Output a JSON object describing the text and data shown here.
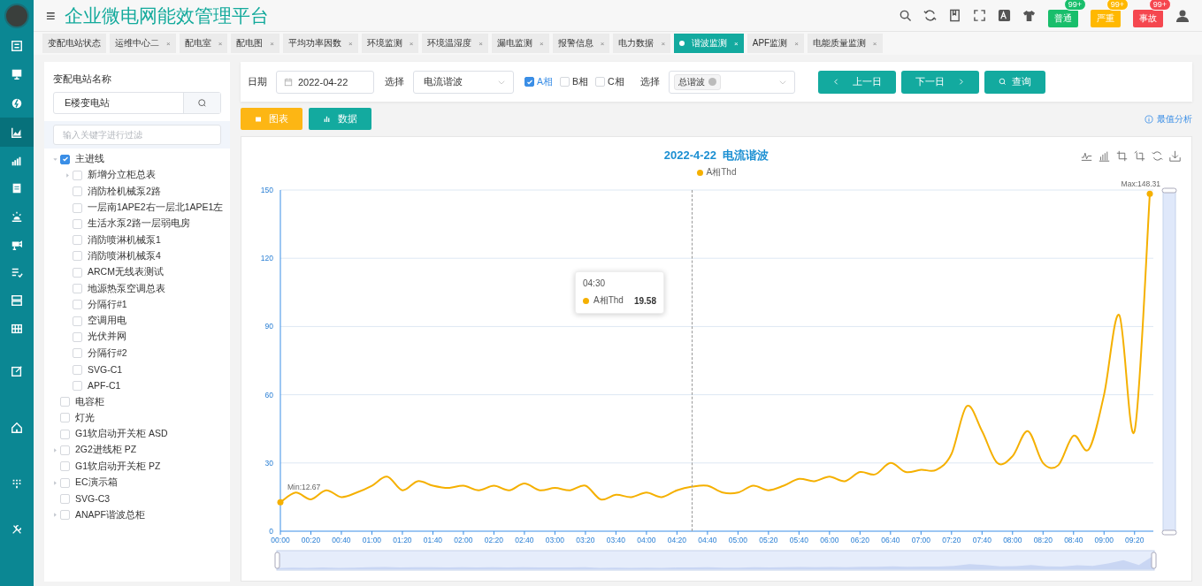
{
  "app": {
    "title": "企业微电网能效管理平台",
    "menu_icon": "≡"
  },
  "rail_items": [
    {
      "selected": false
    },
    {
      "selected": false
    },
    {
      "selected": false
    },
    {
      "selected": true
    },
    {
      "selected": false
    },
    {
      "selected": false
    },
    {
      "selected": false
    },
    {
      "selected": false
    },
    {
      "selected": false
    },
    {
      "selected": false
    },
    {
      "selected": false
    },
    {
      "selected": false
    },
    {
      "selected": false
    },
    {
      "selected": false
    },
    {
      "selected": false
    }
  ],
  "alerts": [
    {
      "label": "普通",
      "count": "99+",
      "color": "#19be6b"
    },
    {
      "label": "严重",
      "count": "99+",
      "color": "#ffb800"
    },
    {
      "label": "事故",
      "count": "99+",
      "color": "#f5474f"
    }
  ],
  "tabs": [
    {
      "label": "变配电站状态",
      "selected": false
    },
    {
      "label": "运维中心二",
      "selected": false,
      "close": "×"
    },
    {
      "label": "配电室",
      "selected": false,
      "close": "×"
    },
    {
      "label": "配电图",
      "selected": false,
      "close": "×"
    },
    {
      "label": "平均功率因数",
      "selected": false,
      "close": "×"
    },
    {
      "label": "环境监测",
      "selected": false,
      "close": "×"
    },
    {
      "label": "环境温湿度",
      "selected": false,
      "close": "×"
    },
    {
      "label": "漏电监测",
      "selected": false,
      "close": "×"
    },
    {
      "label": "报警信息",
      "selected": false,
      "close": "×"
    },
    {
      "label": "电力数据",
      "selected": false,
      "close": "×"
    },
    {
      "label": "谐波监测",
      "selected": true,
      "close": "×"
    },
    {
      "label": "APF监测",
      "selected": false,
      "close": "×"
    },
    {
      "label": "电能质量监测",
      "selected": false,
      "close": "×"
    }
  ],
  "sidebar": {
    "station_label": "变配电站名称",
    "station_value": "E楼变电站",
    "filter_placeholder": "输入关键字进行过滤",
    "tree": [
      {
        "label": "主进线",
        "checked": true,
        "expanded": true,
        "children": [
          {
            "label": "新增分立柜总表",
            "checked": false,
            "expanded": false
          },
          {
            "label": "消防栓机械泵2路",
            "checked": false
          },
          {
            "label": "一层南1APE2右一层北1APE1左",
            "checked": false
          },
          {
            "label": "生活水泵2路一层弱电房",
            "checked": false
          },
          {
            "label": "消防喷淋机械泵1",
            "checked": false
          },
          {
            "label": "消防喷淋机械泵4",
            "checked": false
          },
          {
            "label": "ARCM无线表测试",
            "checked": false
          },
          {
            "label": "地源热泵空调总表",
            "checked": false
          },
          {
            "label": "分隔行#1",
            "checked": false
          },
          {
            "label": "空调用电",
            "checked": false
          },
          {
            "label": "光伏并网",
            "checked": false
          },
          {
            "label": "分隔行#2",
            "checked": false
          },
          {
            "label": "SVG-C1",
            "checked": false
          },
          {
            "label": "APF-C1",
            "checked": false
          }
        ]
      },
      {
        "label": "电容柜",
        "checked": false
      },
      {
        "label": "灯光",
        "checked": false
      },
      {
        "label": "G1软启动开关柜 ASD",
        "checked": false
      },
      {
        "label": "2G2进线柜 PZ",
        "checked": false,
        "expanded": false
      },
      {
        "label": "G1软启动开关柜 PZ",
        "checked": false
      },
      {
        "label": "EC演示箱",
        "checked": false,
        "expanded": false
      },
      {
        "label": "SVG-C3",
        "checked": false
      },
      {
        "label": "ANAPF谐波总柜",
        "checked": false,
        "expanded": false
      }
    ]
  },
  "filters": {
    "date_label": "日期",
    "date_value": "2022-04-22",
    "type_label": "选择",
    "type_value": "电流谐波",
    "phases": [
      {
        "label": "A相",
        "checked": true
      },
      {
        "label": "B相",
        "checked": false
      },
      {
        "label": "C相",
        "checked": false
      }
    ],
    "harmonic_label": "选择",
    "harmonic_tags": [
      "总谐波"
    ],
    "buttons": [
      {
        "kind": "prev",
        "label": "上一日"
      },
      {
        "kind": "next",
        "label": "下一日"
      },
      {
        "kind": "search",
        "label": "查询"
      }
    ]
  },
  "view_buttons": [
    {
      "label": "图表",
      "selected": true
    },
    {
      "label": "数据",
      "selected": false
    }
  ],
  "analysis_link": "最值分析",
  "chart": {
    "tooltip": {
      "time": "04:30",
      "series": "A相Thd",
      "value": "19.58"
    },
    "chart_data": {
      "type": "line",
      "title": "2022-4-22  电流谐波",
      "x": [
        0,
        10,
        20,
        30,
        40,
        50,
        60,
        70,
        80,
        90,
        100,
        110,
        120,
        130,
        140,
        150,
        160,
        170,
        180,
        190,
        200,
        210,
        220,
        230,
        240,
        250,
        260,
        270,
        280,
        290,
        300,
        310,
        320,
        330,
        340,
        350,
        360,
        370,
        380,
        390,
        400,
        410,
        420,
        430,
        440,
        450,
        460,
        470,
        480,
        490,
        500,
        510,
        520,
        530,
        540,
        550,
        560,
        570
      ],
      "series": [
        {
          "name": "A相Thd",
          "color": "#f5b000",
          "values": [
            12.7,
            17,
            14,
            18,
            15,
            17,
            20,
            24,
            18,
            22,
            20,
            19,
            20,
            18,
            20,
            18,
            21,
            18,
            19,
            18,
            20,
            14,
            16,
            15,
            17,
            15,
            18,
            19.6,
            20,
            17,
            17,
            20,
            18,
            20,
            23,
            22,
            24,
            22,
            26,
            25,
            30,
            26,
            27,
            27,
            34,
            55,
            44,
            30,
            33,
            44,
            30,
            29,
            42,
            36,
            60,
            95,
            44,
            148.3
          ]
        }
      ],
      "xlim": [
        0,
        570
      ],
      "xticks": [
        {
          "value": 0,
          "label": "00:00"
        },
        {
          "value": 20,
          "label": "00:20"
        },
        {
          "value": 40,
          "label": "00:40"
        },
        {
          "value": 60,
          "label": "01:00"
        },
        {
          "value": 80,
          "label": "01:20"
        },
        {
          "value": 100,
          "label": "01:40"
        },
        {
          "value": 120,
          "label": "02:00"
        },
        {
          "value": 140,
          "label": "02:20"
        },
        {
          "value": 160,
          "label": "02:40"
        },
        {
          "value": 180,
          "label": "03:00"
        },
        {
          "value": 200,
          "label": "03:20"
        },
        {
          "value": 220,
          "label": "03:40"
        },
        {
          "value": 240,
          "label": "04:00"
        },
        {
          "value": 260,
          "label": "04:20"
        },
        {
          "value": 280,
          "label": "04:40"
        },
        {
          "value": 300,
          "label": "05:00"
        },
        {
          "value": 320,
          "label": "05:20"
        },
        {
          "value": 340,
          "label": "05:40"
        },
        {
          "value": 360,
          "label": "06:00"
        },
        {
          "value": 380,
          "label": "06:20"
        },
        {
          "value": 400,
          "label": "06:40"
        },
        {
          "value": 420,
          "label": "07:00"
        },
        {
          "value": 440,
          "label": "07:20"
        },
        {
          "value": 460,
          "label": "07:40"
        },
        {
          "value": 480,
          "label": "08:00"
        },
        {
          "value": 500,
          "label": "08:20"
        },
        {
          "value": 520,
          "label": "08:40"
        },
        {
          "value": 540,
          "label": "09:00"
        },
        {
          "value": 560,
          "label": "09:20"
        }
      ],
      "ylim": [
        0,
        150
      ],
      "yticks": [
        0,
        30,
        60,
        90,
        120,
        150
      ],
      "grid": true,
      "annotations": [
        {
          "text": "Min:12.67",
          "x": 0,
          "y": 12.7
        },
        {
          "text": "Max:148.31",
          "x": 570,
          "y": 148.3
        }
      ]
    }
  }
}
